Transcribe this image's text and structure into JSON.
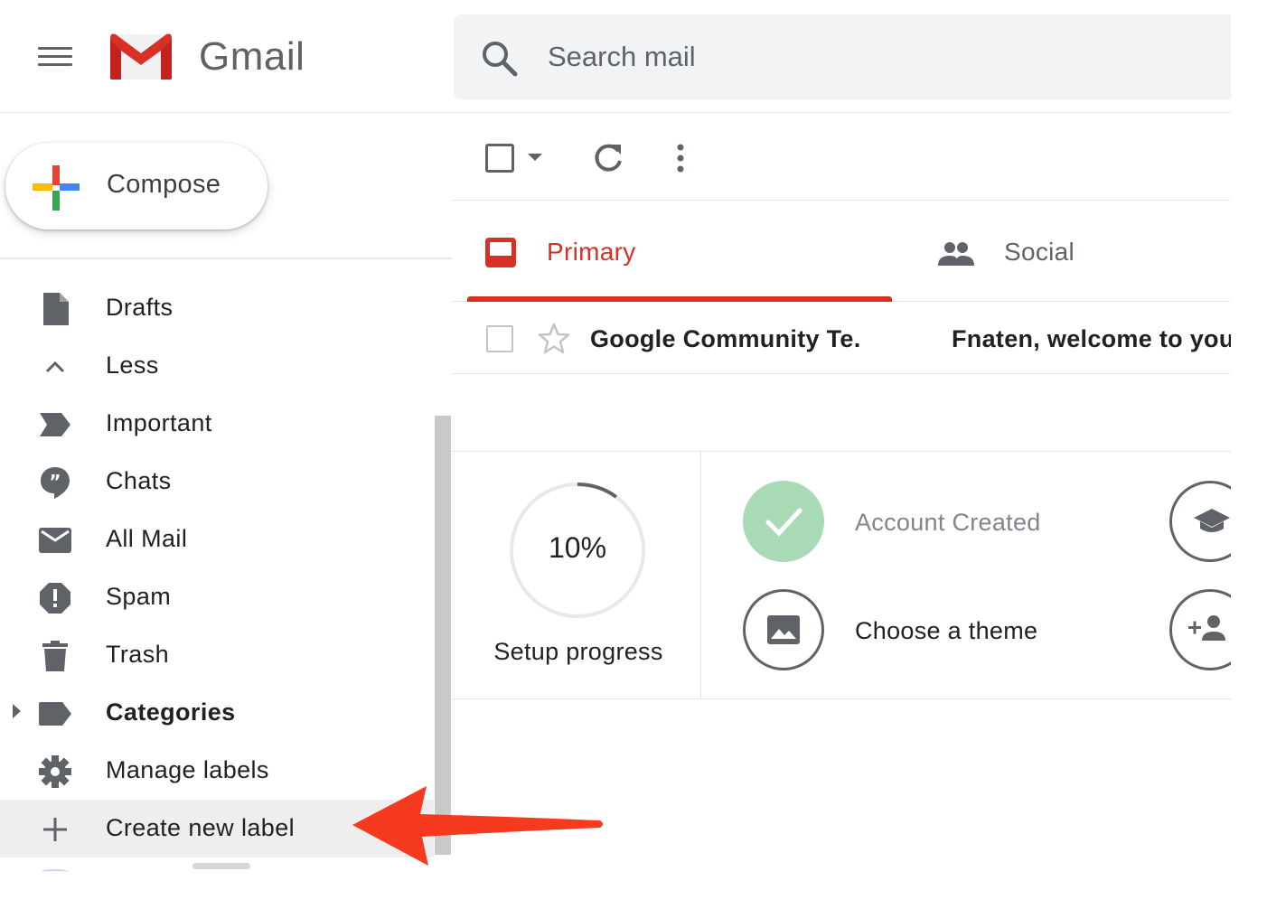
{
  "app": {
    "brand": "Gmail",
    "colors": {
      "accent_red": "#d93025",
      "icon_gray": "#5f6368",
      "done_green": "#a8dab5",
      "arrow_red": "#f53a1f"
    }
  },
  "header": {
    "menu_icon": "hamburger-icon",
    "logo_icon": "gmail-m-logo",
    "search": {
      "icon": "search-icon",
      "placeholder": "Search mail",
      "value": ""
    }
  },
  "sidebar": {
    "compose_label": "Compose",
    "items": [
      {
        "label": "Drafts",
        "icon": "draft-file-icon"
      },
      {
        "label": "Less",
        "icon": "chevron-up-icon"
      },
      {
        "label": "Important",
        "icon": "important-marker-icon"
      },
      {
        "label": "Chats",
        "icon": "chat-bubble-icon"
      },
      {
        "label": "All Mail",
        "icon": "envelope-icon"
      },
      {
        "label": "Spam",
        "icon": "spam-alert-icon"
      },
      {
        "label": "Trash",
        "icon": "trash-icon"
      },
      {
        "label": "Categories",
        "icon": "label-tag-icon",
        "expandable": true
      },
      {
        "label": "Manage labels",
        "icon": "gear-icon"
      },
      {
        "label": "Create new label",
        "icon": "plus-icon",
        "highlighted": true
      }
    ]
  },
  "toolbar": {
    "select_icon": "checkbox-icon",
    "dropdown_icon": "caret-down-icon",
    "refresh_icon": "refresh-icon",
    "more_icon": "more-vert-icon"
  },
  "tabs": [
    {
      "label": "Primary",
      "icon": "inbox-icon",
      "active": true
    },
    {
      "label": "Social",
      "icon": "people-icon",
      "active": false
    }
  ],
  "emails": [
    {
      "sender": "Google Community Te.",
      "subject": "Fnaten, welcome to your",
      "starred": false,
      "unread": true
    }
  ],
  "setup": {
    "progress_fraction": 0.1,
    "progress_text": "10%",
    "label": "Setup progress",
    "steps": [
      {
        "label": "Account Created",
        "icon": "check-icon",
        "done": true
      },
      {
        "label": "Choose a theme",
        "icon": "image-icon",
        "done": false
      }
    ],
    "side_steps": [
      {
        "icon": "graduation-cap-icon"
      },
      {
        "icon": "add-person-icon"
      }
    ]
  }
}
